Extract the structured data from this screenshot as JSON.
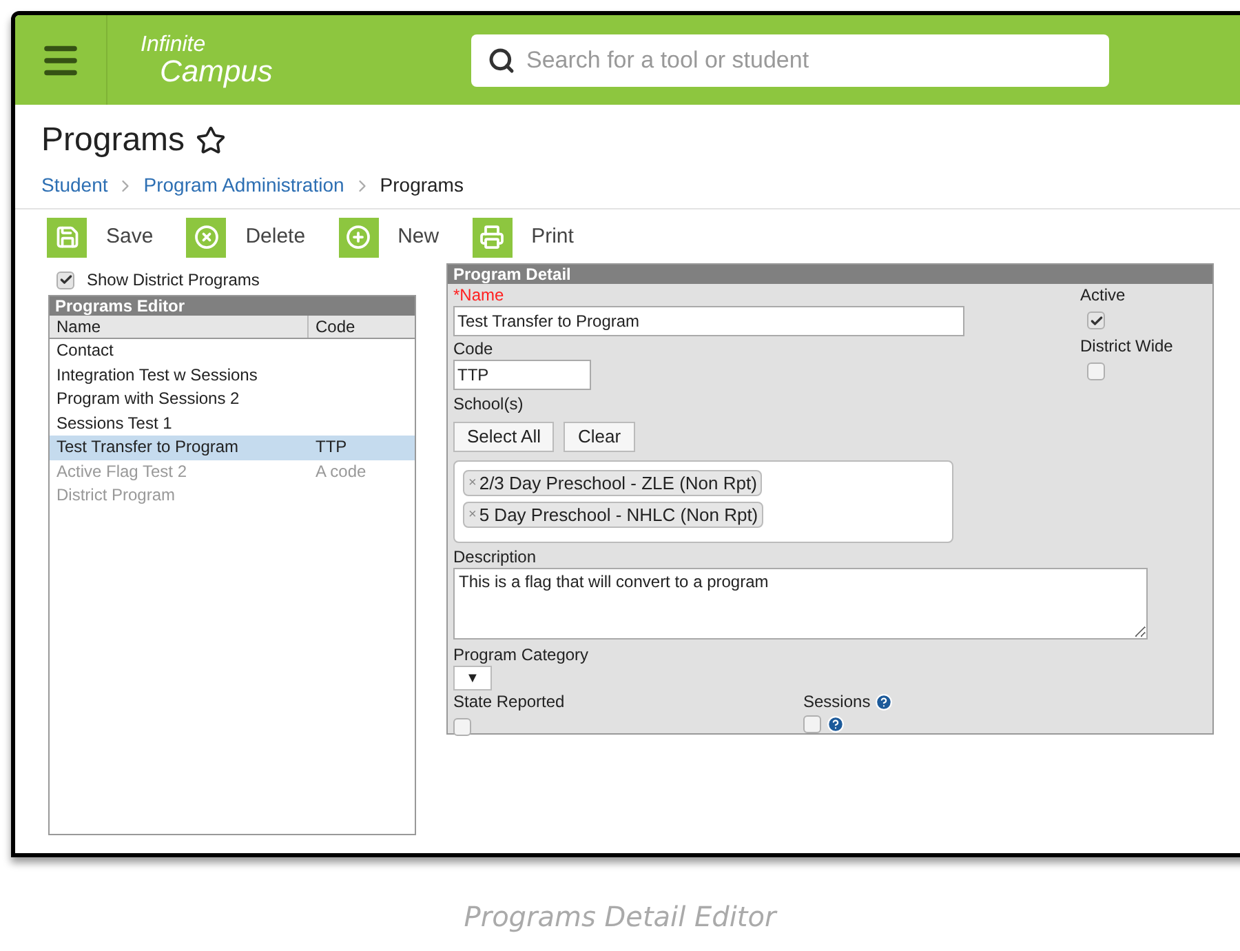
{
  "header": {
    "logo_top": "Infinite",
    "logo_bottom": "Campus",
    "search": {
      "placeholder": "Search for a tool or student"
    }
  },
  "page": {
    "title": "Programs",
    "breadcrumbs": [
      {
        "label": "Student",
        "current": false
      },
      {
        "label": "Program Administration",
        "current": false
      },
      {
        "label": "Programs",
        "current": true
      }
    ]
  },
  "toolbar": [
    {
      "label": "Save",
      "kind": "save"
    },
    {
      "label": "Delete",
      "kind": "delete"
    },
    {
      "label": "New",
      "kind": "new"
    },
    {
      "label": "Print",
      "kind": "print"
    }
  ],
  "show_district_programs": {
    "label": "Show District Programs",
    "checked": true
  },
  "programs_editor": {
    "title": "Programs Editor",
    "columns": [
      "Name",
      "Code"
    ],
    "rows": [
      {
        "name": "Contact",
        "selected": false,
        "inactive": false
      },
      {
        "name": "Integration Test w Sessions",
        "selected": false,
        "inactive": false
      },
      {
        "name": "Program with Sessions 2",
        "selected": false,
        "inactive": false
      },
      {
        "name": "Sessions Test 1",
        "selected": false,
        "inactive": false
      },
      {
        "name": "Test Transfer to Program",
        "code": "TTP",
        "selected": true,
        "inactive": false
      },
      {
        "name": "Active Flag Test 2",
        "code": "A code",
        "selected": false,
        "inactive": true
      },
      {
        "name": "District Program",
        "selected": false,
        "inactive": true
      }
    ]
  },
  "program_detail": {
    "title": "Program Detail",
    "name": {
      "label": "*Name",
      "value": "Test Transfer to Program"
    },
    "code": {
      "label": "Code",
      "value": "TTP"
    },
    "active": {
      "label": "Active",
      "checked": true
    },
    "district_wide": {
      "label": "District Wide",
      "checked": false
    },
    "schools": {
      "label": "School(s)",
      "buttons": [
        "Select All",
        "Clear"
      ],
      "tags": [
        {
          "remove": "×",
          "label": "2/3 Day Preschool - ZLE (Non Rpt)"
        },
        {
          "remove": "×",
          "label": "5 Day Preschool - NHLC (Non Rpt)"
        }
      ]
    },
    "description": {
      "label": "Description",
      "value": "This is a flag that will convert to a program"
    },
    "program_category": {
      "label": "Program Category",
      "value": "▼"
    },
    "state_reported": {
      "label": "State Reported",
      "checked": false
    },
    "sessions": {
      "label": "Sessions",
      "checked": false
    }
  },
  "caption": "Programs Detail Editor"
}
